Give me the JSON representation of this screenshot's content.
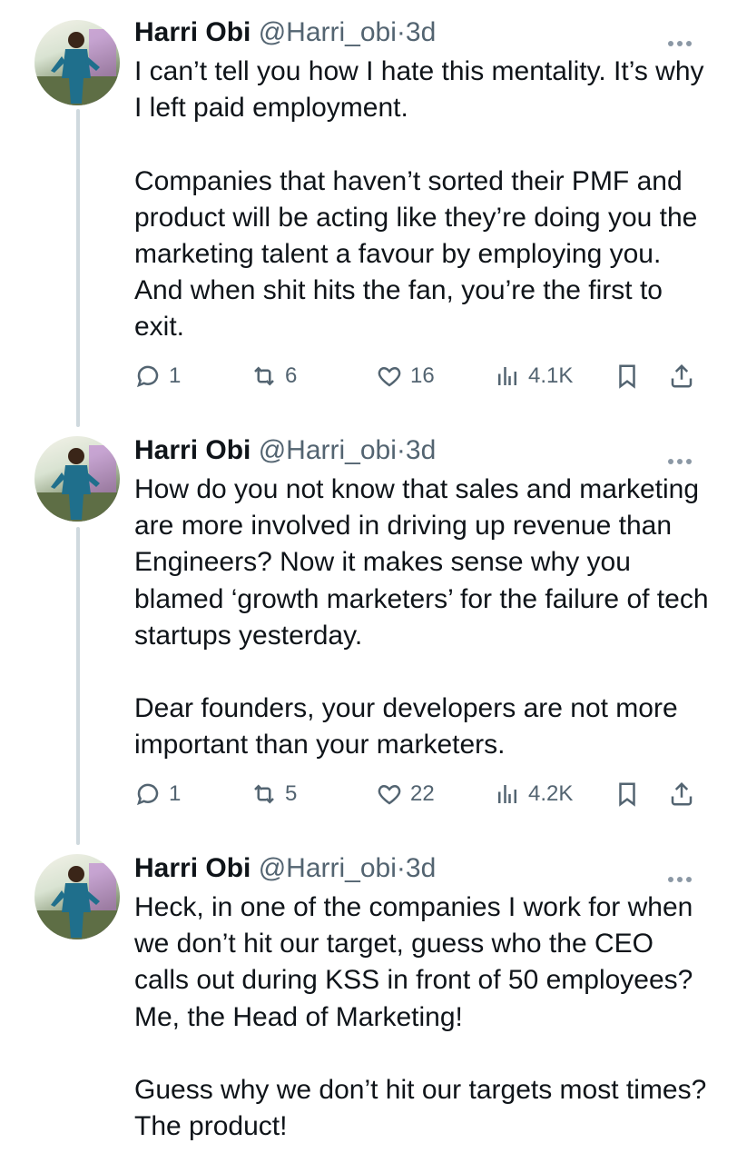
{
  "tweets": [
    {
      "name": "Harri Obi",
      "handle": "@Harri_obi",
      "separator": "·",
      "time": "3d",
      "paragraphs": [
        "I can’t tell you how I hate this mentality. It’s why I left paid employment.",
        "Companies that haven’t sorted their PMF and product will be acting like they’re doing you the marketing talent a favour by employing you. And when shit hits the fan, you’re the first to exit."
      ],
      "replies": "1",
      "reposts": "6",
      "likes": "16",
      "views": "4.1K"
    },
    {
      "name": "Harri Obi",
      "handle": "@Harri_obi",
      "separator": "·",
      "time": "3d",
      "paragraphs": [
        "How do you not know that sales and marketing are more involved in driving up revenue than Engineers? Now it makes sense why you blamed ‘growth marketers’ for the failure of tech startups yesterday.",
        "Dear founders, your developers are not more important than your marketers."
      ],
      "replies": "1",
      "reposts": "5",
      "likes": "22",
      "views": "4.2K"
    },
    {
      "name": "Harri Obi",
      "handle": "@Harri_obi",
      "separator": "·",
      "time": "3d",
      "paragraphs": [
        "Heck, in one of the companies I work for when we don’t hit our target, guess who the CEO calls out during KSS in front of 50 employees? Me, the Head of Marketing!",
        "Guess why we don’t hit our targets most times? The product!"
      ]
    }
  ],
  "icons": {
    "more": "more-horizontal-icon",
    "reply": "reply-icon",
    "repost": "repost-icon",
    "like": "heart-icon",
    "views": "views-icon",
    "bookmark": "bookmark-icon",
    "share": "share-icon"
  },
  "colors": {
    "text": "#0f1419",
    "secondary": "#536471",
    "thread_line": "#cfd9de"
  }
}
